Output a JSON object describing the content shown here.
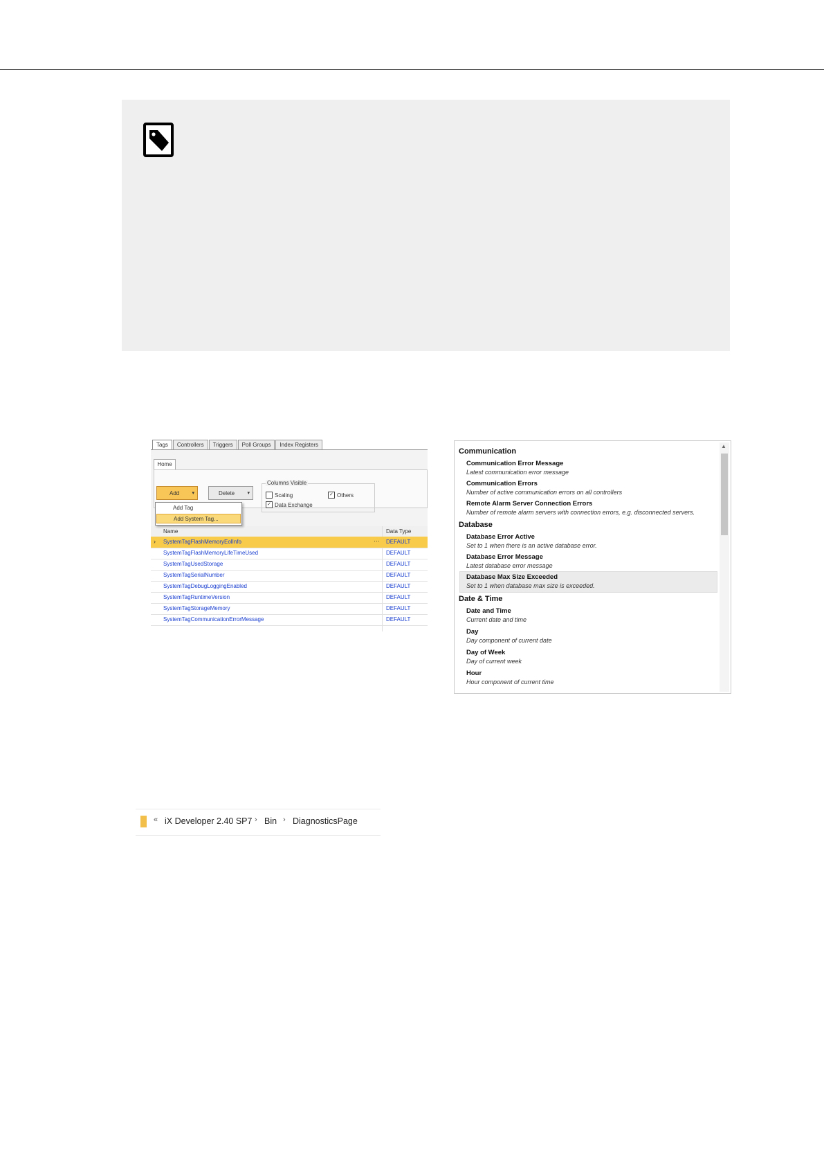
{
  "note": {
    "icon": "note-tag-icon"
  },
  "tag_editor": {
    "tabs": [
      "Tags",
      "Controllers",
      "Triggers",
      "Poll Groups",
      "Index Registers"
    ],
    "ribbon_tab": "Home",
    "add_label": "Add",
    "delete_label": "Delete",
    "columns_visible_label": "Columns Visible",
    "checkboxes": [
      {
        "label": "Scaling",
        "checked": false
      },
      {
        "label": "Data Exchange",
        "checked": true
      },
      {
        "label": "Others",
        "checked": true
      }
    ],
    "add_menu": [
      "Add Tag",
      "Add System Tag..."
    ],
    "columns": [
      "Name",
      "Data Type"
    ],
    "rows": [
      {
        "name": "SystemTagFlashMemoryEolInfo",
        "type": "DEFAULT"
      },
      {
        "name": "SystemTagFlashMemoryLifeTimeUsed",
        "type": "DEFAULT"
      },
      {
        "name": "SystemTagUsedStorage",
        "type": "DEFAULT"
      },
      {
        "name": "SystemTagSerialNumber",
        "type": "DEFAULT"
      },
      {
        "name": "SystemTagDebugLoggingEnabled",
        "type": "DEFAULT"
      },
      {
        "name": "SystemTagRuntimeVersion",
        "type": "DEFAULT"
      },
      {
        "name": "SystemTagStorageMemory",
        "type": "DEFAULT"
      },
      {
        "name": "SystemTagCommunicationErrorMessage",
        "type": "DEFAULT"
      }
    ]
  },
  "system_tags": {
    "categories": [
      {
        "name": "Communication",
        "items": [
          {
            "title": "Communication Error Message",
            "desc": "Latest communication error message"
          },
          {
            "title": "Communication Errors",
            "desc": "Number of active communication errors on all controllers"
          },
          {
            "title": "Remote Alarm Server Connection Errors",
            "desc": "Number of remote alarm servers with connection errors, e.g. disconnected servers."
          }
        ]
      },
      {
        "name": "Database",
        "items": [
          {
            "title": "Database Error Active",
            "desc": "Set to 1 when there is an active database error."
          },
          {
            "title": "Database Error Message",
            "desc": "Latest database error message"
          },
          {
            "title": "Database Max Size Exceeded",
            "desc": "Set to 1 when database max size is exceeded."
          }
        ]
      },
      {
        "name": "Date & Time",
        "items": [
          {
            "title": "Date and Time",
            "desc": "Current date and time"
          },
          {
            "title": "Day",
            "desc": "Day component of current date"
          },
          {
            "title": "Day of Week",
            "desc": "Day of current week"
          },
          {
            "title": "Hour",
            "desc": "Hour component of current time"
          }
        ]
      }
    ]
  },
  "breadcrumb": {
    "chevrons": "«",
    "parts": [
      "iX Developer 2.40 SP7",
      "Bin",
      "DiagnosticsPage"
    ]
  }
}
